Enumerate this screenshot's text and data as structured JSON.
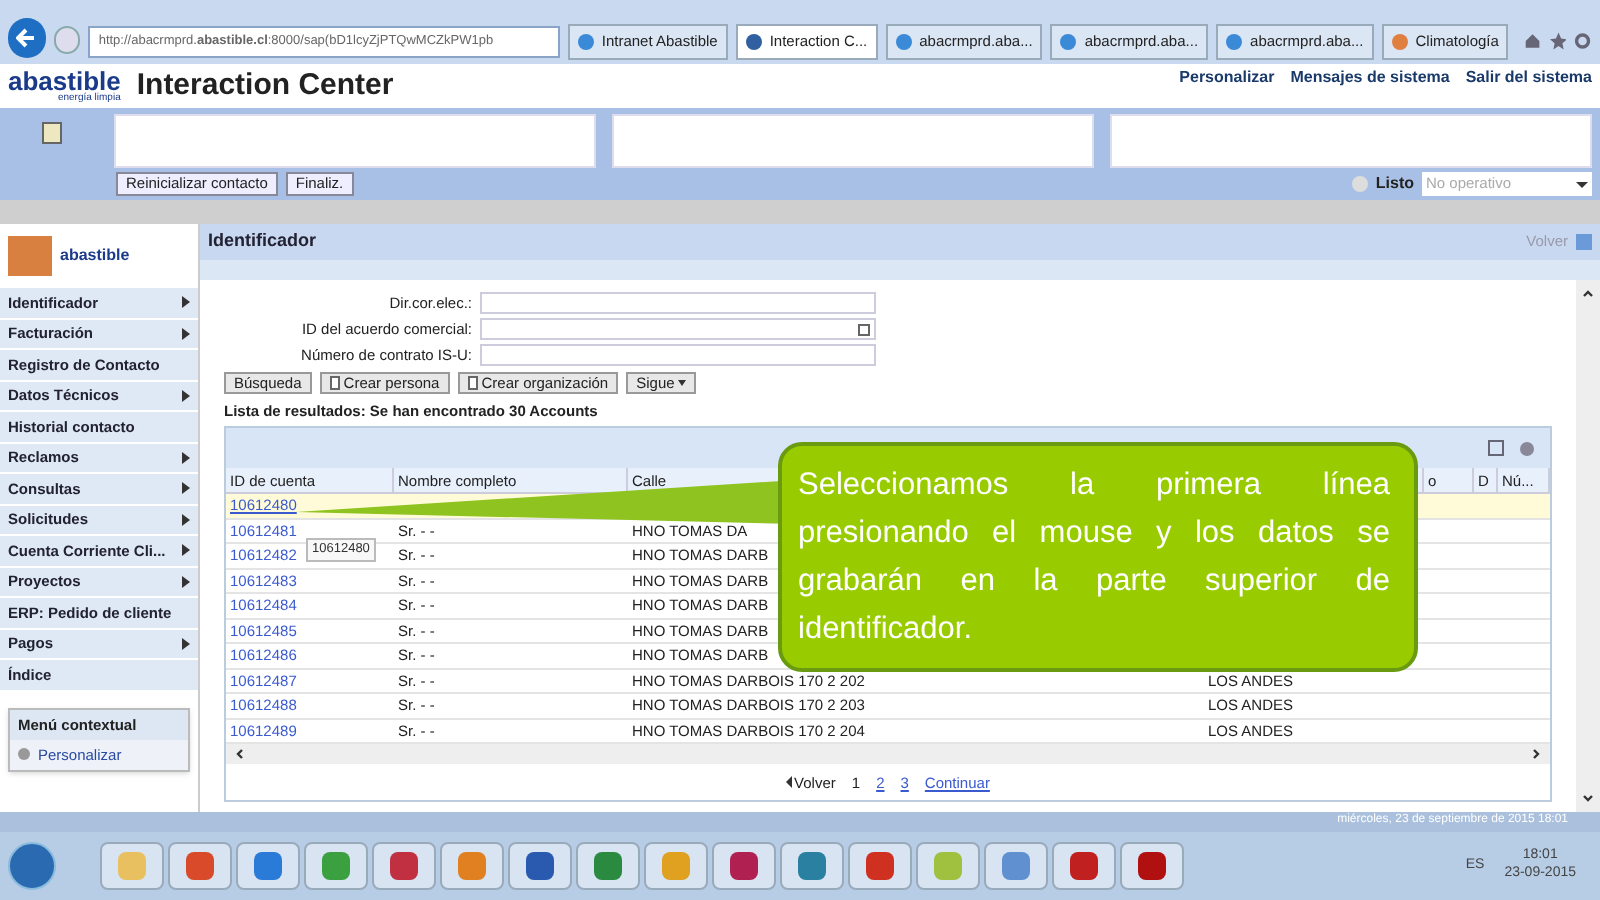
{
  "browser": {
    "address": "http://abacrmprd.**abastible.cl**:8000/sap(bD1lcyZjPTQwMCZkPW1pb",
    "tabs": [
      {
        "label": "Intranet Abastible",
        "selected": false,
        "kind": "ie"
      },
      {
        "label": "Interaction C...",
        "selected": true,
        "kind": "sap"
      },
      {
        "label": "abacrmprd.aba...",
        "selected": false,
        "kind": "ie"
      },
      {
        "label": "abacrmprd.aba...",
        "selected": false,
        "kind": "ie"
      },
      {
        "label": "abacrmprd.aba...",
        "selected": false,
        "kind": "ie"
      },
      {
        "label": "Climatología",
        "selected": false,
        "kind": "web"
      }
    ]
  },
  "header": {
    "logo": "abastible",
    "logo_tagline": "energía limpia",
    "title": "Interaction Center",
    "links": [
      "Personalizar",
      "Mensajes de sistema",
      "Salir del sistema"
    ]
  },
  "toolbar": {
    "buttons": [
      "Reinicializar contacto",
      "Finaliz."
    ],
    "status": "Listo",
    "status_selected": false,
    "status_select": {
      "placeholder": "No operativo"
    }
  },
  "sidebar": {
    "logo": "abastible",
    "items": [
      {
        "label": "Identificador",
        "submenu": true
      },
      {
        "label": "Facturación",
        "submenu": true
      },
      {
        "label": "Registro de Contacto",
        "submenu": false
      },
      {
        "label": "Datos Técnicos",
        "submenu": true
      },
      {
        "label": "Historial contacto",
        "submenu": false
      },
      {
        "label": "Reclamos",
        "submenu": true
      },
      {
        "label": "Consultas",
        "submenu": true
      },
      {
        "label": "Solicitudes",
        "submenu": true
      },
      {
        "label": "Cuenta Corriente Cli...",
        "submenu": true
      },
      {
        "label": "Proyectos",
        "submenu": true
      },
      {
        "label": "ERP: Pedido de cliente",
        "submenu": false
      },
      {
        "label": "Pagos",
        "submenu": true
      },
      {
        "label": "Índice",
        "submenu": false
      }
    ],
    "context_menu": {
      "title": "Menú contextual",
      "items": [
        "Personalizar"
      ]
    }
  },
  "content": {
    "title": "Identificador",
    "nav": [
      "Volver"
    ],
    "fields": [
      {
        "label": "Dir.cor.elec.:",
        "kind": "text"
      },
      {
        "label": "ID del acuerdo comercial:",
        "kind": "lookup"
      },
      {
        "label": "Número de contrato IS-U:",
        "kind": "text"
      }
    ],
    "buttons": [
      {
        "label": "Búsqueda",
        "kind": "plain"
      },
      {
        "label": "Crear persona",
        "kind": "new"
      },
      {
        "label": "Crear organización",
        "kind": "new"
      },
      {
        "label": "Sigue",
        "kind": "menu"
      }
    ],
    "result_title": "Lista de resultados: Se han encontrado 30 Accounts",
    "table": {
      "columns": [
        {
          "label": "ID de cuenta"
        },
        {
          "label": "Nombre completo"
        },
        {
          "label": "Calle"
        },
        {},
        {
          "label": "o"
        },
        {
          "label": "D"
        },
        {
          "label": "Nú..."
        }
      ],
      "rows": [
        {
          "id": "10612480",
          "selected": true
        },
        {
          "id": "10612481",
          "name": "Sr. - -",
          "street": "HNO TOMAS DA",
          "selected": false
        },
        {
          "id": "10612482",
          "name": "Sr. - -",
          "street": "HNO TOMAS DARB",
          "selected": false
        },
        {
          "id": "10612483",
          "name": "Sr. - -",
          "street": "HNO TOMAS DARB",
          "selected": false
        },
        {
          "id": "10612484",
          "name": "Sr. - -",
          "street": "HNO TOMAS DARB",
          "selected": false
        },
        {
          "id": "10612485",
          "name": "Sr. - -",
          "street": "HNO TOMAS DARB",
          "selected": false
        },
        {
          "id": "10612486",
          "name": "Sr. - -",
          "street": "HNO TOMAS DARB",
          "selected": false
        },
        {
          "id": "10612487",
          "name": "Sr. - -",
          "street": "HNO TOMAS DARBOIS 170 2 202",
          "city": "LOS ANDES",
          "selected": false
        },
        {
          "id": "10612488",
          "name": "Sr. - -",
          "street": "HNO TOMAS DARBOIS 170 2 203",
          "city": "LOS ANDES",
          "selected": false
        },
        {
          "id": "10612489",
          "name": "Sr. - -",
          "street": "HNO TOMAS DARBOIS 170 2 204",
          "city": "LOS ANDES",
          "selected": false
        }
      ],
      "tooltip": "10612480"
    },
    "pagination": {
      "prev": "Volver",
      "pages": [
        {
          "label": "1",
          "selected": true
        },
        {
          "label": "2",
          "selected": false
        },
        {
          "label": "3",
          "selected": false
        }
      ],
      "next": "Continuar"
    }
  },
  "callout": "Seleccionamos la primera línea presionando el mouse y los datos se grabarán en la parte superior de identificador.",
  "status_line": "miércoles, 23 de septiembre de 2015 18:01",
  "taskbar": {
    "apps": [
      {
        "color": "#e8c060"
      },
      {
        "color": "#d84a2a"
      },
      {
        "color": "#2a7ad8"
      },
      {
        "color": "#3aa040"
      },
      {
        "color": "#c03040"
      },
      {
        "color": "#e08020"
      },
      {
        "color": "#2a5ab0"
      },
      {
        "color": "#2a8a40"
      },
      {
        "color": "#e0a020"
      },
      {
        "color": "#b02050"
      },
      {
        "color": "#2a80a0"
      },
      {
        "color": "#d03020"
      },
      {
        "color": "#a0c040"
      },
      {
        "color": "#6090d0"
      },
      {
        "color": "#c02020"
      },
      {
        "color": "#b01010"
      }
    ],
    "language": "ES",
    "time": "18:01",
    "date": "23-09-2015"
  }
}
